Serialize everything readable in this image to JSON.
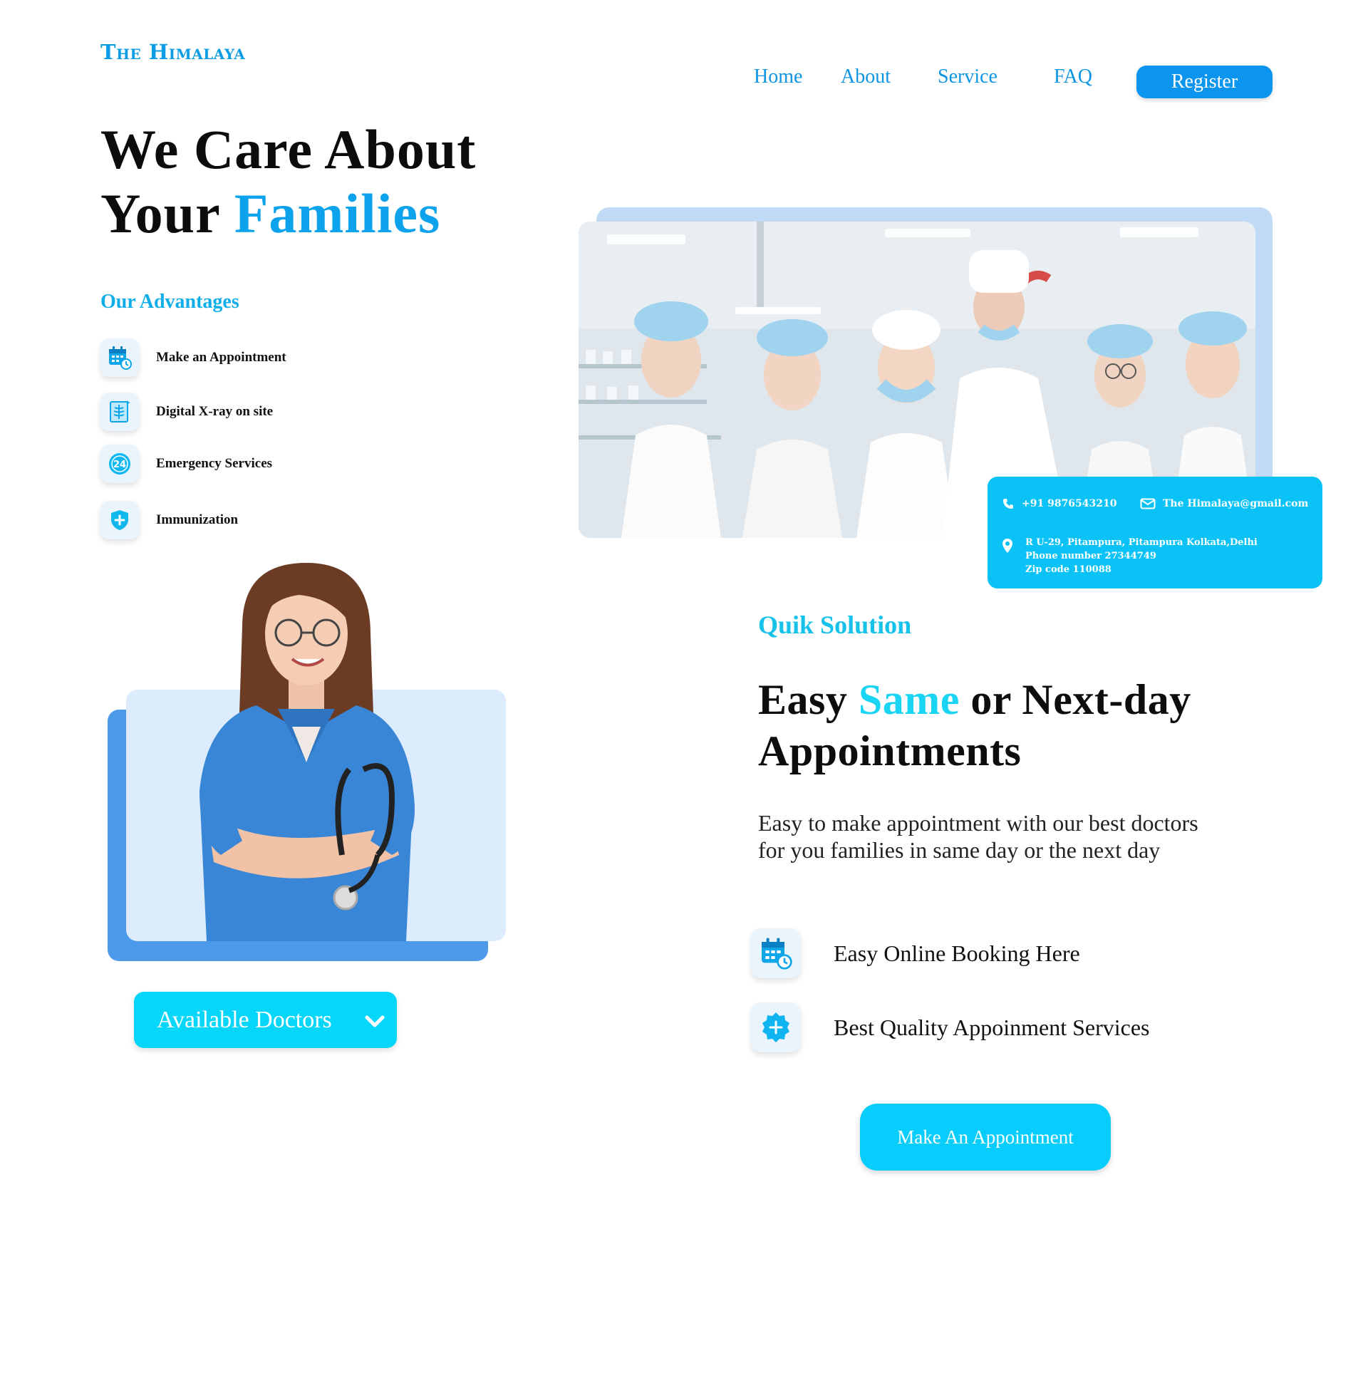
{
  "brand": {
    "logo": "The Himalaya"
  },
  "nav": {
    "home": "Home",
    "about": "About",
    "service": "Service",
    "faq": "FAQ",
    "register": "Register"
  },
  "hero": {
    "line1": "We Care About",
    "line2_plain": "Your ",
    "line2_accent": "Families"
  },
  "advantages": {
    "heading": "Our Advantages",
    "items": [
      {
        "label": "Make an Appointment",
        "icon": "calendar-clock-icon"
      },
      {
        "label": "Digital X-ray on site",
        "icon": "xray-icon"
      },
      {
        "label": "Emergency Services",
        "icon": "24-hours-icon"
      },
      {
        "label": "Immunization",
        "icon": "shield-plus-icon"
      }
    ]
  },
  "contact": {
    "phone": "+91 9876543210",
    "email": "The Himalaya@gmail.com",
    "address_line1": "R U-29, Pitampura, Pitampura Kolkata,Delhi",
    "address_line2": "Phone number  27344749",
    "address_line3": "Zip code  110088"
  },
  "available_doctors": {
    "label": "Available Doctors"
  },
  "solution": {
    "kicker": "Quik Solution",
    "title_part1": "Easy ",
    "title_accent": "Same",
    "title_part2": " or Next-day",
    "title_line2": "Appointments",
    "description_line1": "Easy to make appointment with our best doctors",
    "description_line2": "for you families in same day or the next day",
    "features": [
      {
        "label": "Easy Online Booking Here",
        "icon": "calendar-clock-icon"
      },
      {
        "label": "Best Quality Appoinment Services",
        "icon": "plus-badge-icon"
      }
    ],
    "cta": "Make An Appointment"
  },
  "colors": {
    "accent_blue": "#0c95ee",
    "accent_cyan": "#06d6fa",
    "text_dark": "#0d0d0d"
  }
}
